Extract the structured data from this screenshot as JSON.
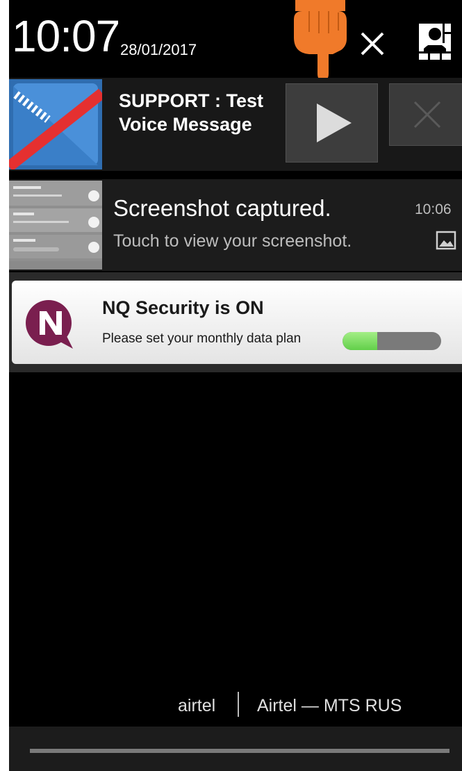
{
  "status": {
    "time": "10:07",
    "date": "28/01/2017"
  },
  "notifications": {
    "voice": {
      "title": "SUPPORT : Test Voice Message",
      "play_icon": "play-icon",
      "dismiss_icon": "close-icon"
    },
    "screenshot": {
      "title": "Screenshot captured.",
      "subtitle": "Touch to view your screenshot.",
      "time": "10:06",
      "icon": "image-icon"
    },
    "nq": {
      "title": "NQ Security is ON",
      "subtitle": "Please set your monthly data plan",
      "progress": 0.35
    }
  },
  "carriers": {
    "sim1": "airtel",
    "sim2": "Airtel — MTS RUS"
  },
  "colors": {
    "background": "#000000",
    "pointer_accent": "#f07a2a",
    "nq_brand": "#7a1f4f",
    "progress_green": "#6ed655"
  }
}
